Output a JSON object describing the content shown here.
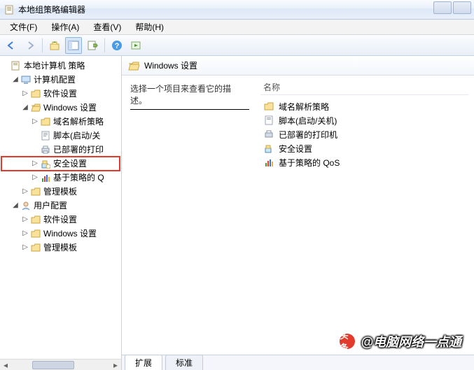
{
  "window": {
    "title": "本地组策略编辑器"
  },
  "menu": {
    "file": "文件(F)",
    "action": "操作(A)",
    "view": "查看(V)",
    "help": "帮助(H)"
  },
  "tree": {
    "root": "本地计算机 策略",
    "computer_cfg": "计算机配置",
    "comp_sw": "软件设置",
    "comp_win": "Windows 设置",
    "comp_win_dns": "域名解析策略",
    "comp_win_script": "脚本(启动/关",
    "comp_win_printer": "已部署的打印",
    "comp_win_security": "安全设置",
    "comp_win_qos": "基于策略的 Q",
    "comp_admin": "管理模板",
    "user_cfg": "用户配置",
    "user_sw": "软件设置",
    "user_win": "Windows 设置",
    "user_admin": "管理模板"
  },
  "content": {
    "heading": "Windows 设置",
    "desc_hint": "选择一个项目来查看它的描述。",
    "column_name": "名称",
    "items": {
      "dns": "域名解析策略",
      "script": "脚本(启动/关机)",
      "printer": "已部署的打印机",
      "security": "安全设置",
      "qos": "基于策略的 QoS"
    },
    "tabs": {
      "extended": "扩展",
      "standard": "标准"
    }
  },
  "watermark": {
    "prefix": "头条",
    "text": "@电脑网络一点通"
  }
}
